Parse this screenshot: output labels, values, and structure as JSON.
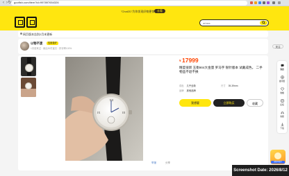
{
  "browser": {
    "url": "goofish.com/item?id=997897654326",
    "back_glyph": "‹",
    "forward_glyph": "›",
    "reload_glyph": "↻"
  },
  "header": {
    "promo_text": "\"Chat2D\"为你发现好物更惊喜",
    "promo_button": "去看",
    "search_placeholder": "ariass"
  },
  "banner": {
    "text": "网页版本告别2月末更新"
  },
  "seller": {
    "name": "以物不渡",
    "badge": "信用极好",
    "meta": "1天前来过 · 卖出30件宝贝 · 好评率100%",
    "follow": "关注"
  },
  "product": {
    "price_symbol": "¥",
    "price": "17999",
    "price_note": "",
    "description": "精度很新 玉衡904大金量 罗马字 银针版本 试戴成色。 二手物品不退不换",
    "attrs": [
      {
        "key": "成色",
        "value": "几乎全新"
      },
      {
        "key": "尺寸",
        "value": "39-39mm"
      },
      {
        "key": "品牌",
        "value": "其他品牌"
      }
    ],
    "buy_label": "我想要",
    "chat_label": "立即购买",
    "want_label": "收藏",
    "report_label": "举报",
    "fav_link": "分享"
  },
  "sidebar": {
    "items": [
      {
        "label": "消息",
        "icon": "message-icon"
      },
      {
        "label": "发闲置",
        "icon": "post-icon"
      },
      {
        "label": "收藏",
        "icon": "heart-icon"
      },
      {
        "label": "反馈",
        "icon": "feedback-icon"
      },
      {
        "label": "客服",
        "icon": "service-icon"
      },
      {
        "label": "下载",
        "icon": "download-icon"
      }
    ]
  },
  "mascot": {
    "tag": "闲鱼AI助手"
  },
  "overlay": {
    "screenshot_date": "Screenshot Date: 2026/8/12"
  },
  "colors": {
    "brand_yellow": "#ffe60f",
    "price_red": "#ff4400",
    "dark": "#222222"
  }
}
